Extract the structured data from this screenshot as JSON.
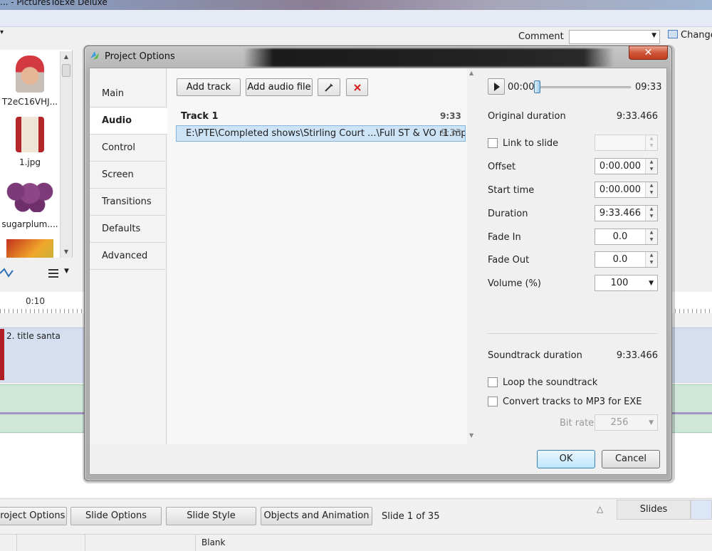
{
  "app": {
    "title": "... - PicturesToExe Deluxe",
    "comment_label": "Comment",
    "comment_value": "",
    "change_label": "Change",
    "thumbnails": [
      {
        "name": "T2eC16VHJ..."
      },
      {
        "name": "1.jpg"
      },
      {
        "name": "sugarplum...."
      }
    ],
    "timeline_time": "0:10",
    "slide_label": "2. title santa",
    "bottom_buttons": [
      "Project Options",
      "Slide Options",
      "Slide Style",
      "Objects and Animation"
    ],
    "slide_count": "Slide 1 of 35",
    "slides_tab": "Slides",
    "status_text": "Blank"
  },
  "dialog": {
    "title": "Project Options",
    "close_symbol": "✕",
    "nav": [
      "Main",
      "Audio",
      "Control",
      "Screen",
      "Transitions",
      "Defaults",
      "Advanced"
    ],
    "active_nav": "Audio",
    "buttons": {
      "add_track": "Add track",
      "add_audio_file": "Add audio file",
      "edit_icon": "pencil-icon",
      "delete_icon": "delete-icon"
    },
    "track": {
      "name": "Track 1",
      "total": "9:33",
      "file": "E:\\PTE\\Completed shows\\Stirling Court ...\\Full ST & VO r1.mp3",
      "file_duration": "9:33"
    },
    "player": {
      "position": "00:00",
      "end": "09:33",
      "progress": 0
    },
    "original_duration_label": "Original duration",
    "original_duration": "9:33.466",
    "link_to_slide_label": "Link to slide",
    "link_to_slide_checked": false,
    "link_to_slide_value": "",
    "fields": {
      "offset": {
        "label": "Offset",
        "value": "0:00.000"
      },
      "start_time": {
        "label": "Start time",
        "value": "0:00.000"
      },
      "duration": {
        "label": "Duration",
        "value": "9:33.466"
      },
      "fade_in": {
        "label": "Fade In",
        "value": "0.0"
      },
      "fade_out": {
        "label": "Fade Out",
        "value": "0.0"
      },
      "volume": {
        "label": "Volume (%)",
        "value": "100"
      }
    },
    "soundtrack_duration_label": "Soundtrack duration",
    "soundtrack_duration": "9:33.466",
    "loop_label": "Loop the soundtrack",
    "loop_checked": false,
    "convert_label": "Convert tracks to MP3 for EXE",
    "convert_checked": false,
    "bit_rate_label": "Bit rate",
    "bit_rate_value": "256",
    "ok": "OK",
    "cancel": "Cancel"
  },
  "colors": {
    "selection": "#cde3f6",
    "close_button": "#d0573a",
    "audio_track": "#cfe7d9",
    "slide_track": "#d5dff0",
    "delete_red": "#d61f1f"
  }
}
